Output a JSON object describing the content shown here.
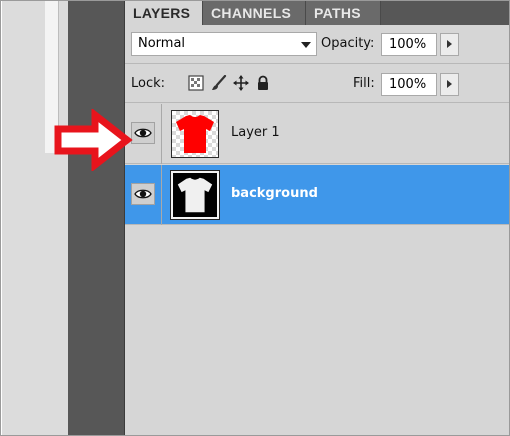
{
  "tabs": [
    {
      "label": "LAYERS",
      "active": true
    },
    {
      "label": "CHANNELS",
      "active": false
    },
    {
      "label": "PATHS",
      "active": false
    }
  ],
  "blend_mode": {
    "value": "Normal"
  },
  "opacity": {
    "label": "Opacity:",
    "value": "100%"
  },
  "lock": {
    "label": "Lock:",
    "icons": [
      "lock-transparent-pixels-icon",
      "lock-image-pixels-icon",
      "lock-position-icon",
      "lock-all-icon"
    ]
  },
  "fill": {
    "label": "Fill:",
    "value": "100%"
  },
  "layers": [
    {
      "name": "Layer 1",
      "visible": true,
      "selected": false,
      "thumbnail": "red-tshirt-icon"
    },
    {
      "name": "background",
      "visible": true,
      "selected": true,
      "thumbnail": "white-tshirt-icon"
    }
  ],
  "annotation": {
    "icon": "red-arrow-icon",
    "color": "#e8141c"
  },
  "colors": {
    "selection": "#3f97ea",
    "panel": "#d6d6d6",
    "tab_inactive": "#6a6a6a",
    "shirt_red": "#ff0000"
  }
}
